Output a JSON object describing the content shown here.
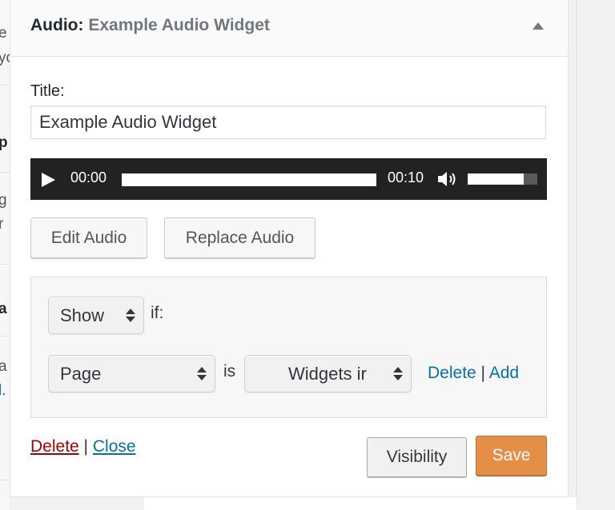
{
  "left_fragments": [
    {
      "text": "e",
      "style": "plain"
    },
    {
      "text": "yo",
      "style": "plain"
    },
    {
      "text": "p",
      "style": "bold"
    },
    {
      "text": "g",
      "style": "plain"
    },
    {
      "text": "r",
      "style": "plain"
    },
    {
      "text": "a",
      "style": "bold"
    },
    {
      "text": "a",
      "style": "plain"
    },
    {
      "text": "l.",
      "style": "link"
    }
  ],
  "widget": {
    "title_prefix": "Audio:",
    "title_name": "Example Audio Widget",
    "toggle_icon": "triangle-up-icon"
  },
  "form": {
    "title_label": "Title:",
    "title_value": "Example Audio Widget"
  },
  "player": {
    "current_time": "00:00",
    "duration": "00:10",
    "progress": 0,
    "volume": 0.8,
    "play_icon": "play-icon",
    "volume_icon": "speaker-icon"
  },
  "buttons": {
    "edit_audio": "Edit Audio",
    "replace_audio": "Replace Audio",
    "visibility": "Visibility",
    "save": "Save"
  },
  "visibility_rules": {
    "action": "Show",
    "if_text": "if:",
    "condition": "Page",
    "is_text": "is",
    "target": "Widgets ir",
    "delete_link": "Delete",
    "separator": "|",
    "add_link": "Add"
  },
  "footer": {
    "delete_link": "Delete",
    "separator": "|",
    "close_link": "Close"
  },
  "colors": {
    "save_button": "#e58e45",
    "link": "#0073aa",
    "delete_link": "#aa0000",
    "player_bg": "#222222"
  }
}
